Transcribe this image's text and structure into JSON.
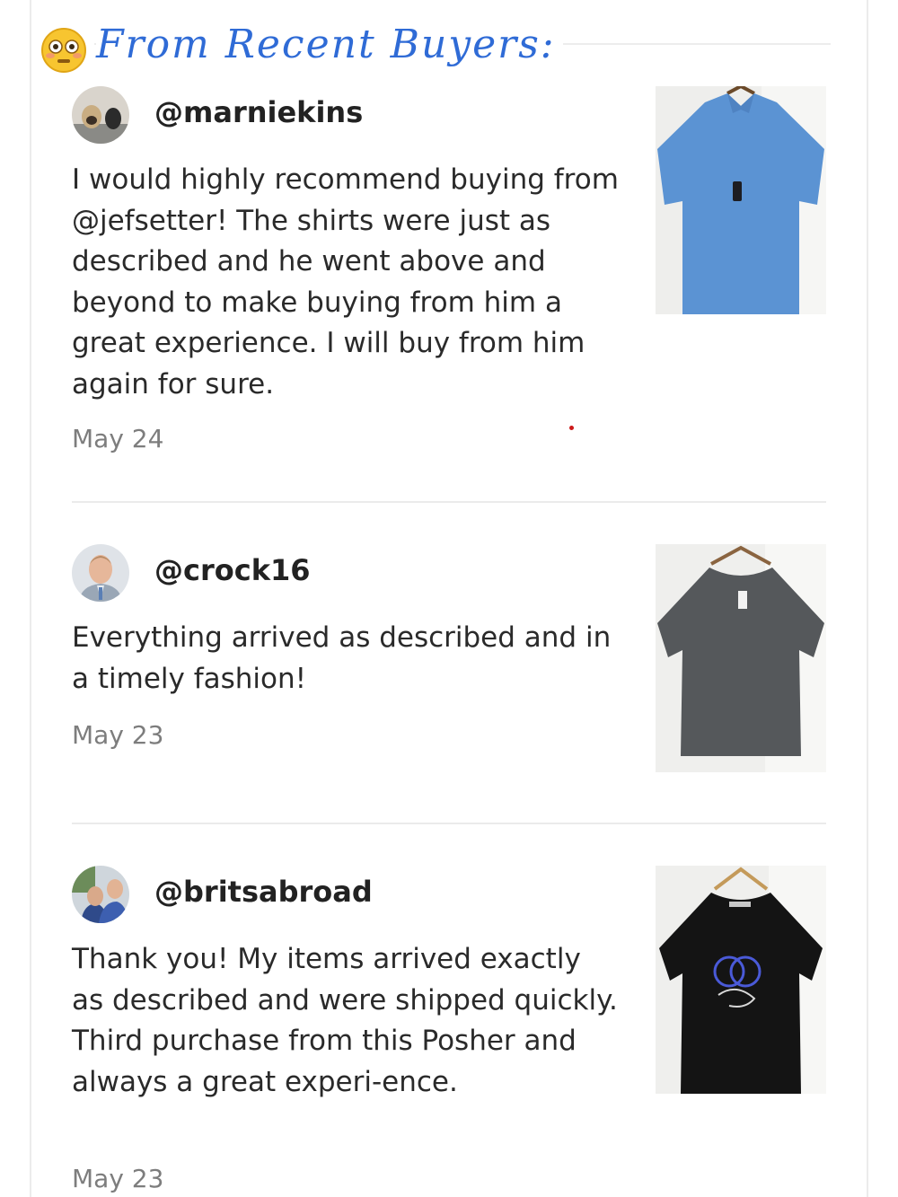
{
  "header": {
    "title": "From Recent Buyers:",
    "emoji_icon": "flushed-face-icon"
  },
  "reviews": [
    {
      "username": "@marniekins",
      "text": "I would highly recommend buying from @jefsetter! The shirts were just as described and he went above and beyond to make buying from him a great experience. I will buy from him again for sure.",
      "date": "May 24",
      "avatar_icon": "pug-avatar",
      "photo_icon": "blue-polo-shirt-photo",
      "photo_color": "#5b93d3"
    },
    {
      "username": "@crock16",
      "text": "Everything arrived as described and in a timely fashion!",
      "date": "May 23",
      "avatar_icon": "man-portrait-avatar",
      "photo_icon": "gray-tshirt-photo",
      "photo_color": "#55585b"
    },
    {
      "username": "@britsabroad",
      "text": "Thank you! My items arrived exactly as described and were shipped quickly. Third purchase from this Posher and always a great experi-ence.",
      "date": "May 23",
      "avatar_icon": "couple-selfie-avatar",
      "photo_icon": "black-graphic-tshirt-photo",
      "photo_color": "#141414"
    }
  ],
  "colors": {
    "accent": "#2f6bd6",
    "date": "#7d7d7d",
    "divider": "#ebebeb"
  }
}
